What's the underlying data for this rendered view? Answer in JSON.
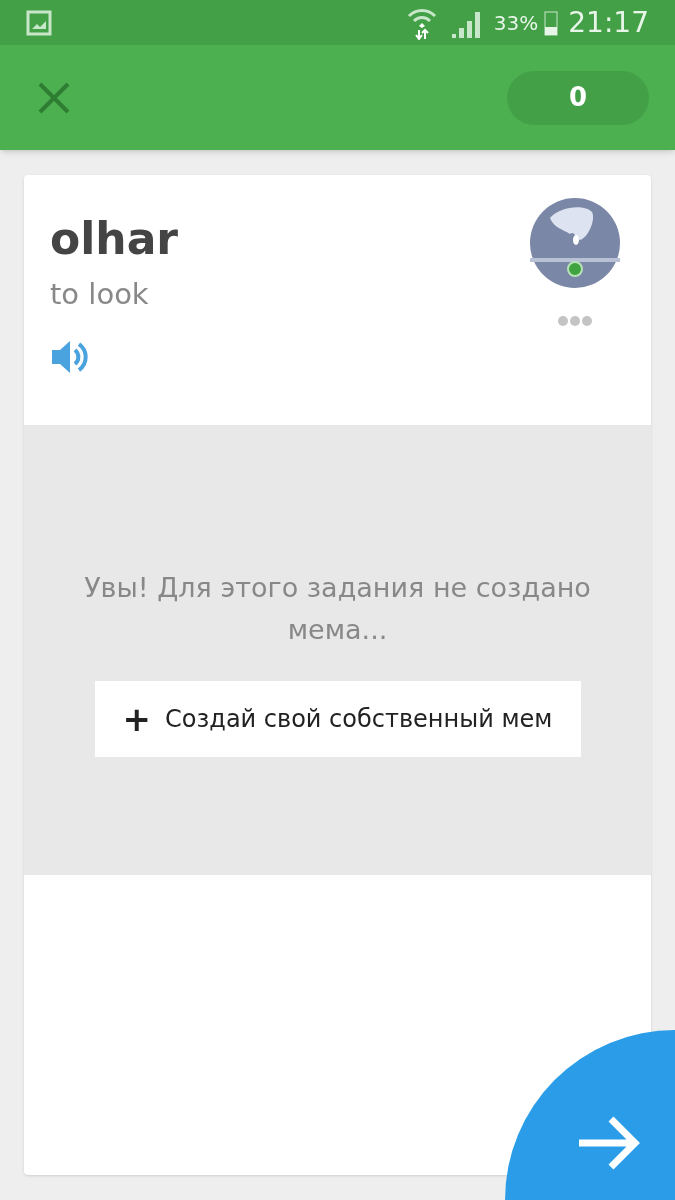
{
  "status_bar": {
    "battery_percent": "33%",
    "time": "21:17"
  },
  "header": {
    "score": "0"
  },
  "card": {
    "word": "olhar",
    "translation": "to look",
    "empty_message": "Увы! Для этого задания не создано мема...",
    "create_button": {
      "icon": "+",
      "label": "Создай свой собственный мем"
    }
  }
}
